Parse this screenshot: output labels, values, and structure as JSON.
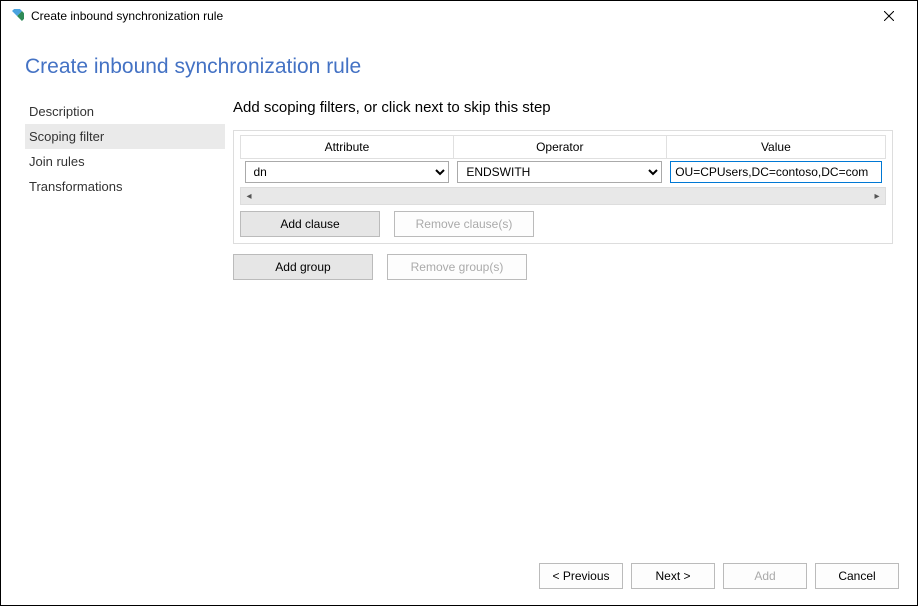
{
  "titlebar": {
    "title": "Create inbound synchronization rule"
  },
  "page": {
    "heading": "Create inbound synchronization rule"
  },
  "sidebar": {
    "items": [
      {
        "label": "Description",
        "active": false
      },
      {
        "label": "Scoping filter",
        "active": true
      },
      {
        "label": "Join rules",
        "active": false
      },
      {
        "label": "Transformations",
        "active": false
      }
    ]
  },
  "main": {
    "heading": "Add scoping filters, or click next to skip this step",
    "columns": {
      "attribute": "Attribute",
      "operator": "Operator",
      "value": "Value"
    },
    "row": {
      "attribute": "dn",
      "operator": "ENDSWITH",
      "value": "OU=CPUsers,DC=contoso,DC=com"
    },
    "buttons": {
      "add_clause": "Add clause",
      "remove_clause": "Remove clause(s)",
      "add_group": "Add group",
      "remove_group": "Remove group(s)"
    }
  },
  "footer": {
    "previous": "< Previous",
    "next": "Next >",
    "add": "Add",
    "cancel": "Cancel"
  }
}
